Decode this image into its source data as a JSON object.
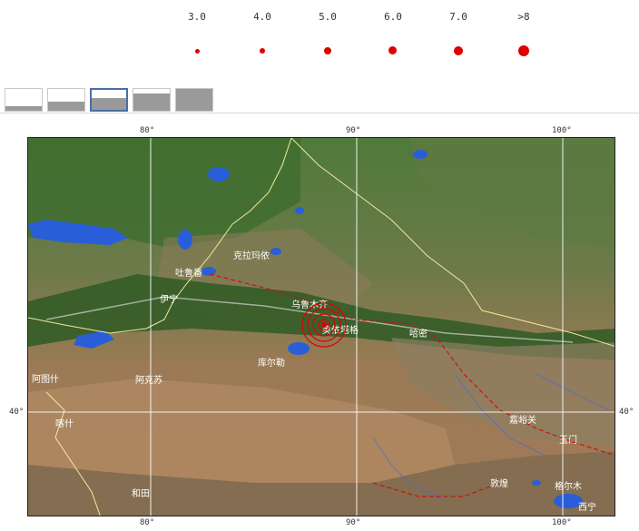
{
  "legend": {
    "magnitudes": [
      {
        "label": "3.0",
        "size": 5
      },
      {
        "label": "4.0",
        "size": 6
      },
      {
        "label": "5.0",
        "size": 8
      },
      {
        "label": "6.0",
        "size": 9
      },
      {
        "label": "7.0",
        "size": 10
      },
      {
        "label": ">8",
        "size": 12
      }
    ],
    "dot_color": "#e00000"
  },
  "layer_tabs": [
    {
      "name": "layer-1",
      "fill_fraction": 0.2,
      "active": false
    },
    {
      "name": "layer-2",
      "fill_fraction": 0.4,
      "active": false
    },
    {
      "name": "layer-3",
      "fill_fraction": 0.6,
      "active": true
    },
    {
      "name": "layer-4",
      "fill_fraction": 0.8,
      "active": false
    },
    {
      "name": "layer-5",
      "fill_fraction": 1.0,
      "active": false
    }
  ],
  "map": {
    "lon_labels_top": [
      "80°",
      "90°",
      "100°"
    ],
    "lon_labels_bottom": [
      "80°",
      "90°",
      "100°"
    ],
    "lat_labels": [
      "40°",
      "40°"
    ],
    "places": [
      "乌鲁木齐",
      "克拉玛依",
      "奥依塔格",
      "吐鲁番",
      "哈密",
      "库尔勒",
      "阿克苏",
      "喀什",
      "和田",
      "敦煌",
      "玉门",
      "嘉峪关",
      "格尔木",
      "西宁",
      "伊宁",
      "阿图什"
    ],
    "epicenter_color": "#e00000"
  }
}
